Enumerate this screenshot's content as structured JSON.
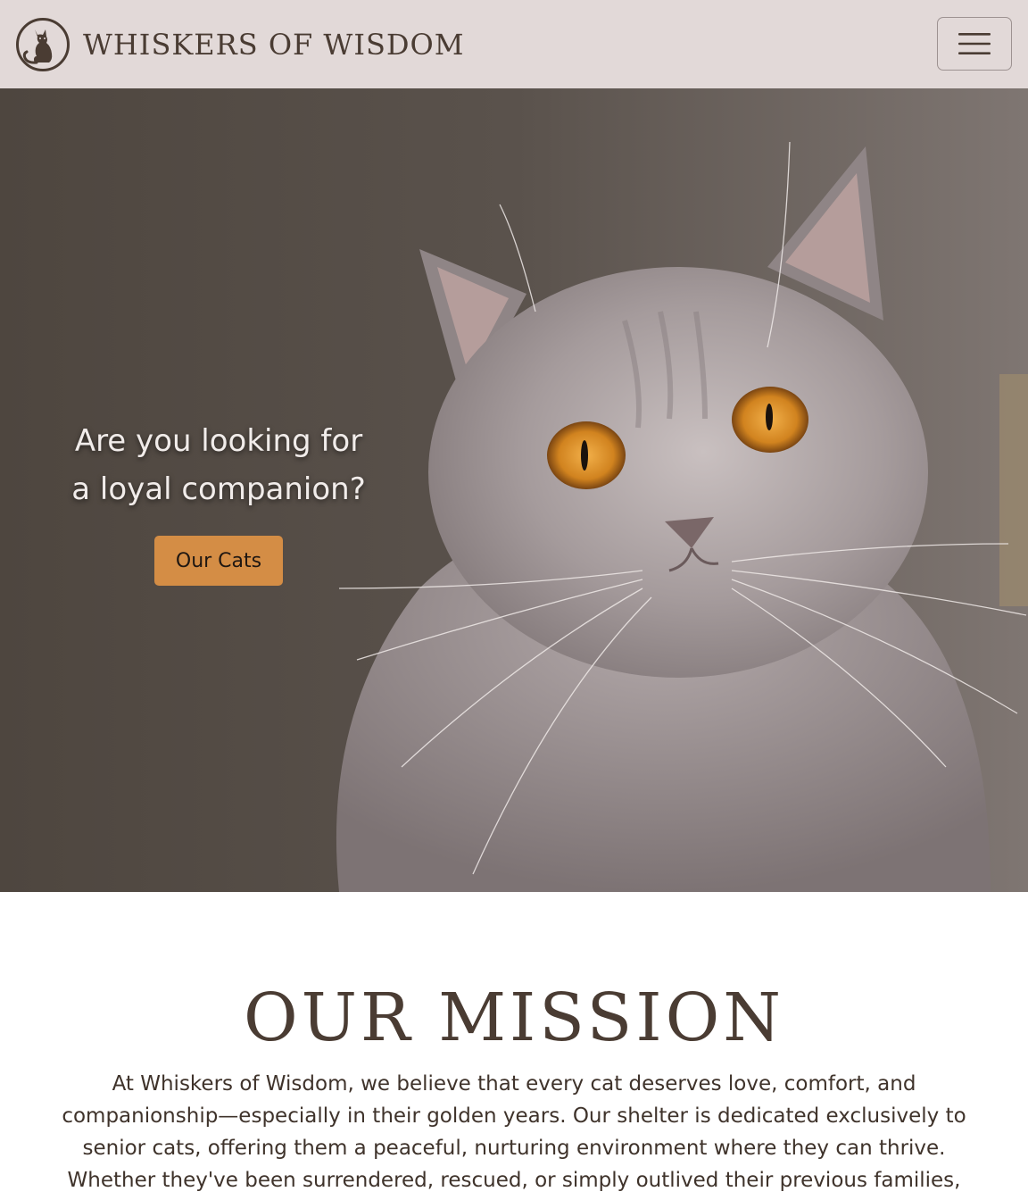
{
  "navbar": {
    "brand_name": "WHISKERS OF WISDOM",
    "logo_icon": "cat-logo-icon",
    "menu_icon": "hamburger-menu-icon",
    "background_color": "#e2d9d8",
    "text_color": "#4a3c33"
  },
  "hero": {
    "heading_line1": "Are you looking for",
    "heading_line2": "a loyal companion?",
    "button_label": "Our Cats",
    "button_color": "#d48d45",
    "image": "gray-british-shorthair-cat-photo"
  },
  "mission": {
    "title": "OUR MISSION",
    "text": "At Whiskers of Wisdom, we believe that every cat deserves love, comfort, and companionship—especially in their golden years. Our shelter is dedicated exclusively to senior cats, offering them a peaceful, nurturing environment where they can thrive. Whether they've been surrendered, rescued, or simply outlived their previous families,"
  }
}
